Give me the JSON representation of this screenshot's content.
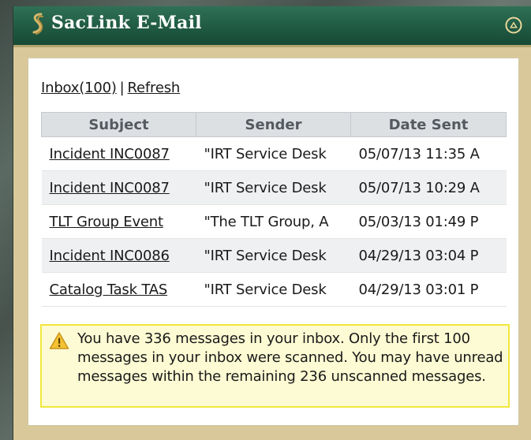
{
  "window": {
    "title": "SacLink E-Mail",
    "logo_icon": "sac-state-s-logo-icon",
    "collapse_icon": "collapse-up-icon"
  },
  "toolbar": {
    "inbox_label": "Inbox(100)",
    "separator": "|",
    "refresh_label": "Refresh"
  },
  "table": {
    "headers": [
      "Subject",
      "Sender",
      "Date Sent"
    ],
    "rows": [
      {
        "subject": "Incident INC0087",
        "sender": "\"IRT Service Desk",
        "date": "05/07/13 11:35 A"
      },
      {
        "subject": "Incident INC0087",
        "sender": "\"IRT Service Desk",
        "date": "05/07/13 10:29 A"
      },
      {
        "subject": "TLT Group Event",
        "sender": "\"The TLT Group, A",
        "date": "05/03/13 01:49 P"
      },
      {
        "subject": "Incident INC0086",
        "sender": "\"IRT Service Desk",
        "date": "04/29/13 03:04 P"
      },
      {
        "subject": "Catalog Task TAS",
        "sender": "\"IRT Service Desk",
        "date": "04/29/13 03:01 P"
      }
    ]
  },
  "alert": {
    "icon": "warning-icon",
    "message": "You have 336 messages in your inbox. Only the first 100 messages in your inbox were scanned. You may have unread messages within the remaining 236 unscanned messages."
  },
  "colors": {
    "titlebar": "#205a43",
    "frame": "#d9c99a",
    "alert_border": "#f1e73a",
    "alert_background": "#fdfbd3"
  }
}
